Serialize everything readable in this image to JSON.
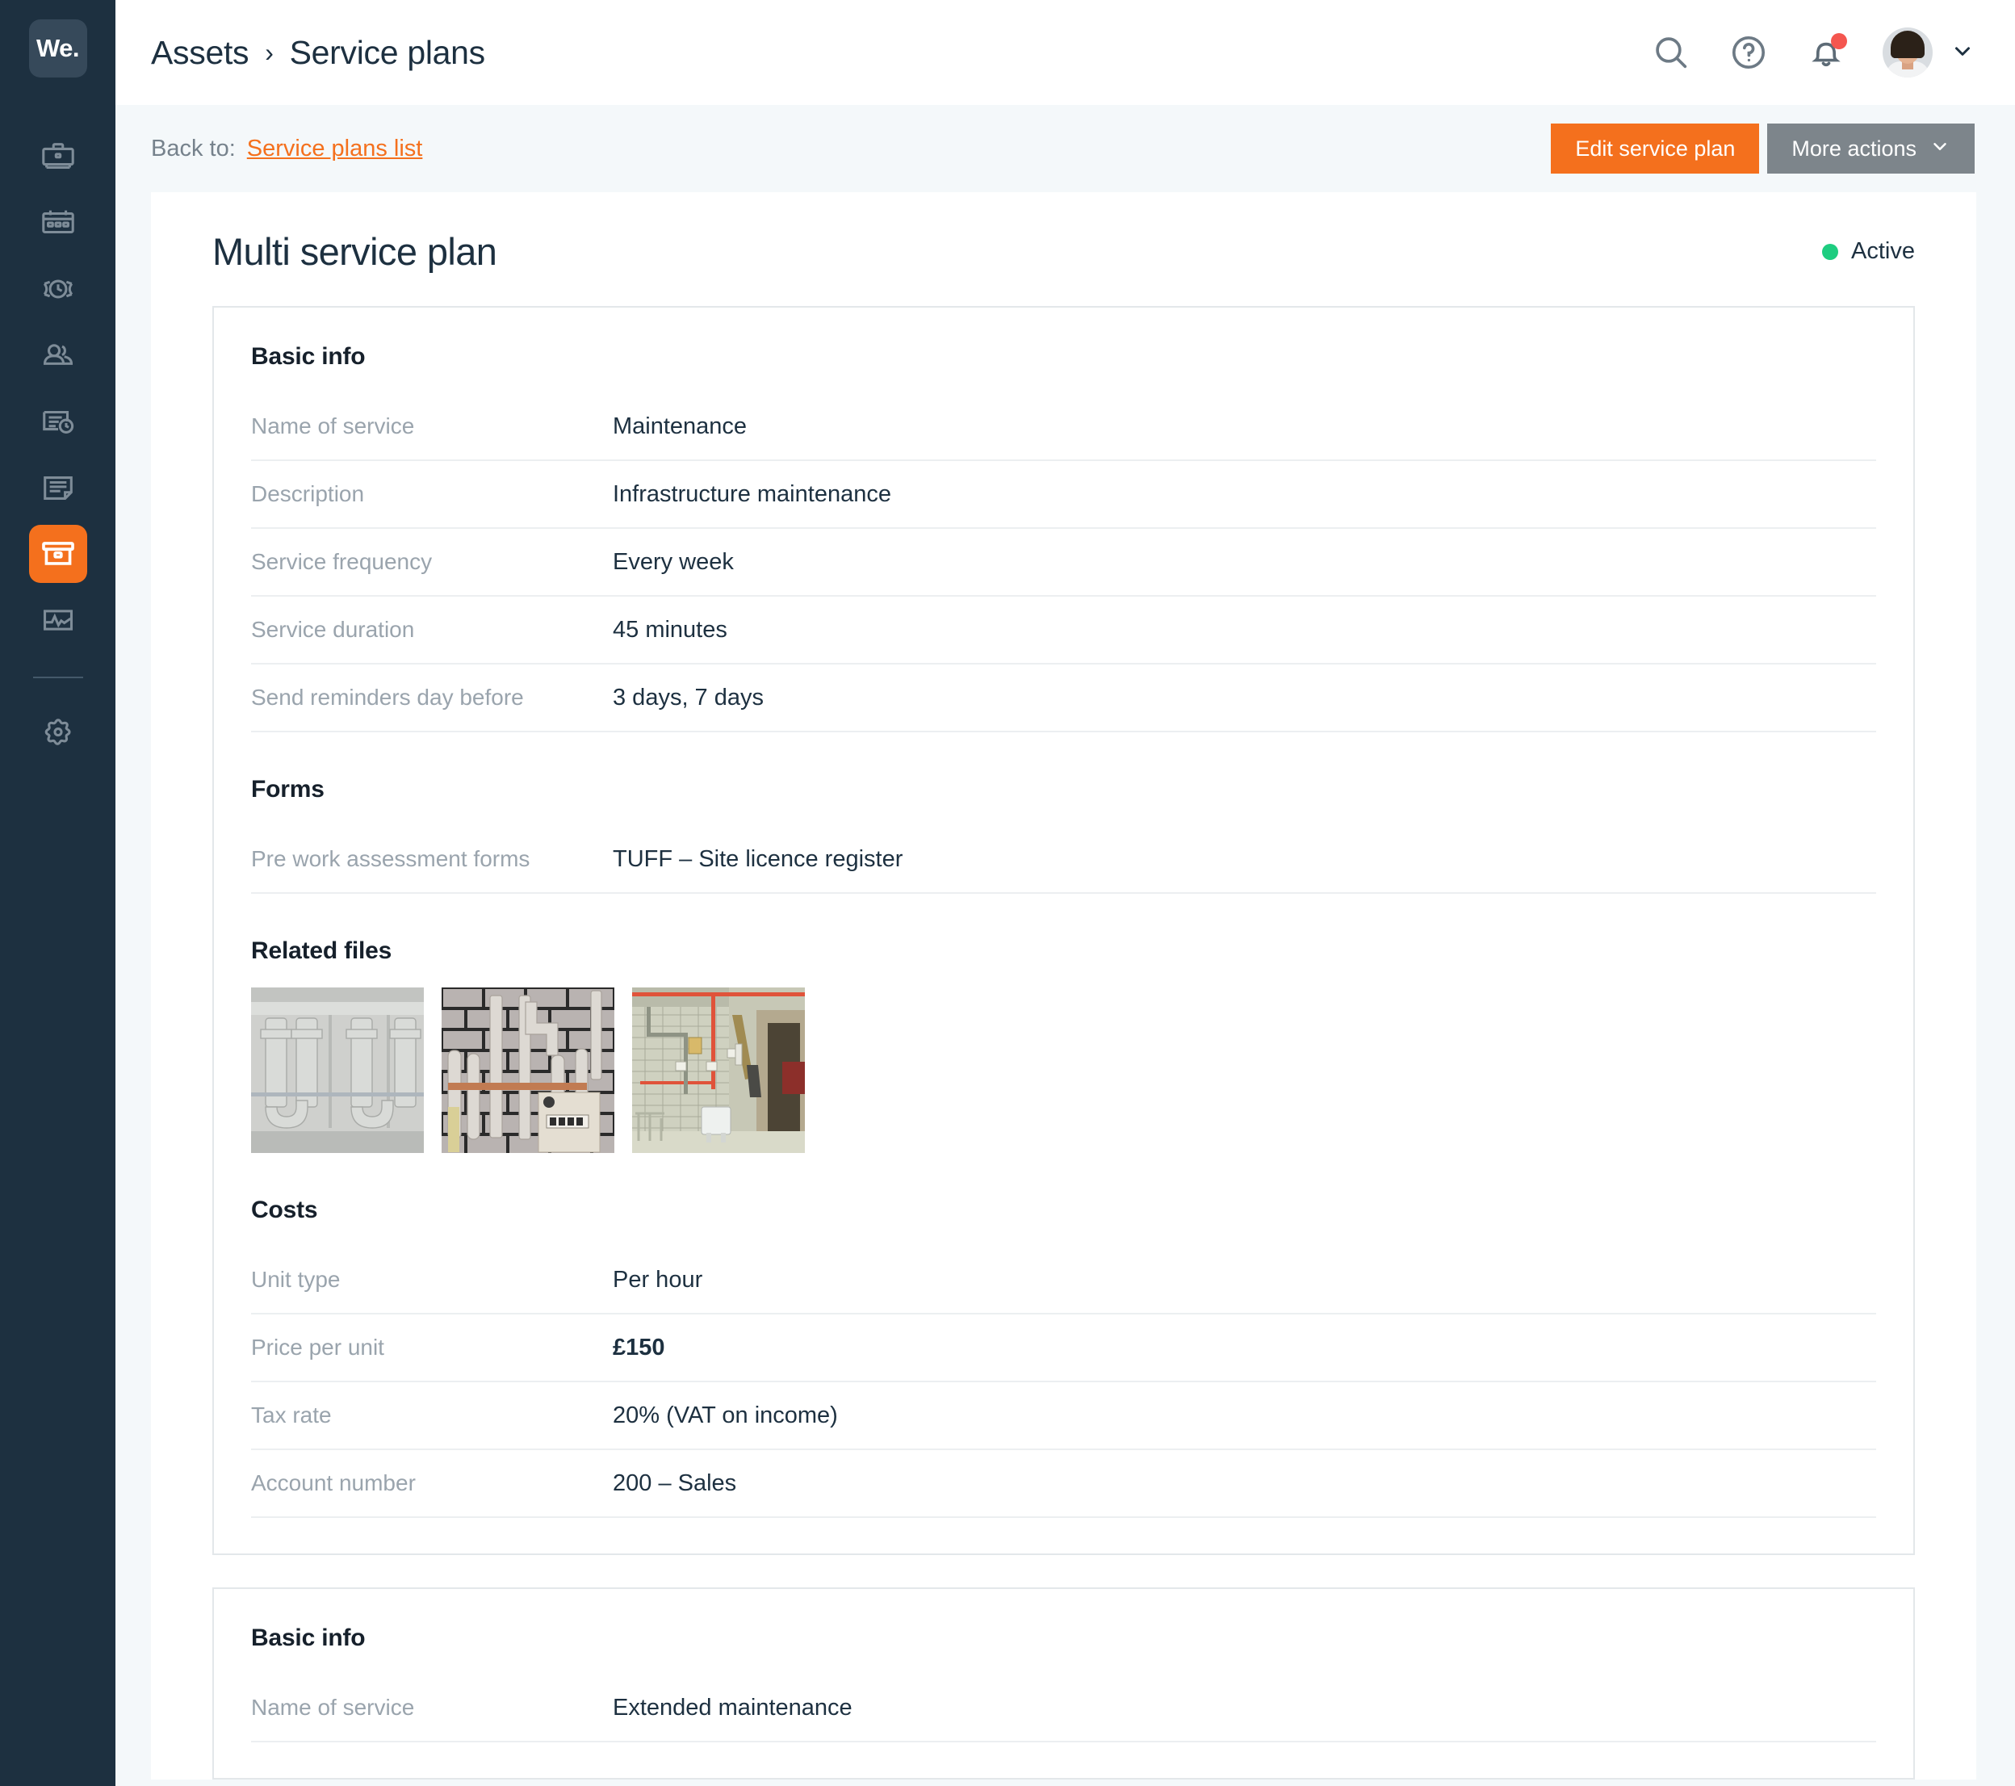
{
  "brand": {
    "logo_text": "We."
  },
  "sidebar": {
    "items": [
      {
        "icon": "toolbox-icon",
        "name": "sidebar-item-jobs",
        "active": false
      },
      {
        "icon": "calendar-icon",
        "name": "sidebar-item-schedule",
        "active": false
      },
      {
        "icon": "timer-icon",
        "name": "sidebar-item-timesheets",
        "active": false
      },
      {
        "icon": "people-icon",
        "name": "sidebar-item-customers",
        "active": false
      },
      {
        "icon": "invoice-clock-icon",
        "name": "sidebar-item-quotes",
        "active": false
      },
      {
        "icon": "document-icon",
        "name": "sidebar-item-forms",
        "active": false
      },
      {
        "icon": "assets-box-icon",
        "name": "sidebar-item-assets",
        "active": true
      },
      {
        "icon": "reports-chart-icon",
        "name": "sidebar-item-reports",
        "active": false
      },
      {
        "icon": "gear-icon",
        "name": "sidebar-item-settings",
        "active": false
      }
    ]
  },
  "header": {
    "breadcrumb": {
      "parent": "Assets",
      "separator": "›",
      "current": "Service plans"
    },
    "icons": {
      "search": "search-icon",
      "help": "help-circle-icon",
      "notifications": "bell-icon",
      "avatar_chevron": "chevron-down-icon"
    }
  },
  "subheader": {
    "back_label": "Back to:",
    "back_link": "Service plans list",
    "edit_button": "Edit service plan",
    "more_button": "More actions"
  },
  "page": {
    "title": "Multi service plan",
    "status": "Active",
    "status_color": "#1ecd80",
    "accent_color": "#f4701d"
  },
  "plan_1": {
    "basic_info": {
      "heading": "Basic info",
      "rows": [
        {
          "label": "Name of service",
          "value": "Maintenance"
        },
        {
          "label": "Description",
          "value": "Infrastructure maintenance"
        },
        {
          "label": "Service frequency",
          "value": "Every week"
        },
        {
          "label": "Service duration",
          "value": "45 minutes"
        },
        {
          "label": "Send reminders day before",
          "value": "3 days, 7 days"
        }
      ]
    },
    "forms": {
      "heading": "Forms",
      "rows": [
        {
          "label": "Pre work assessment forms",
          "value": "TUFF – Site licence register"
        }
      ]
    },
    "related_files": {
      "heading": "Related files",
      "thumbnails": [
        {
          "name": "thumbnail-pipes-grey"
        },
        {
          "name": "thumbnail-pipes-brick-wall"
        },
        {
          "name": "thumbnail-boiler-room"
        }
      ]
    },
    "costs": {
      "heading": "Costs",
      "rows": [
        {
          "label": "Unit type",
          "value": "Per hour"
        },
        {
          "label": "Price per unit",
          "value": "£150",
          "bold": true
        },
        {
          "label": "Tax rate",
          "value": "20% (VAT on income)"
        },
        {
          "label": "Account number",
          "value": "200 – Sales"
        }
      ]
    }
  },
  "plan_2": {
    "basic_info": {
      "heading": "Basic info",
      "rows": [
        {
          "label": "Name of service",
          "value": "Extended maintenance"
        }
      ]
    }
  }
}
